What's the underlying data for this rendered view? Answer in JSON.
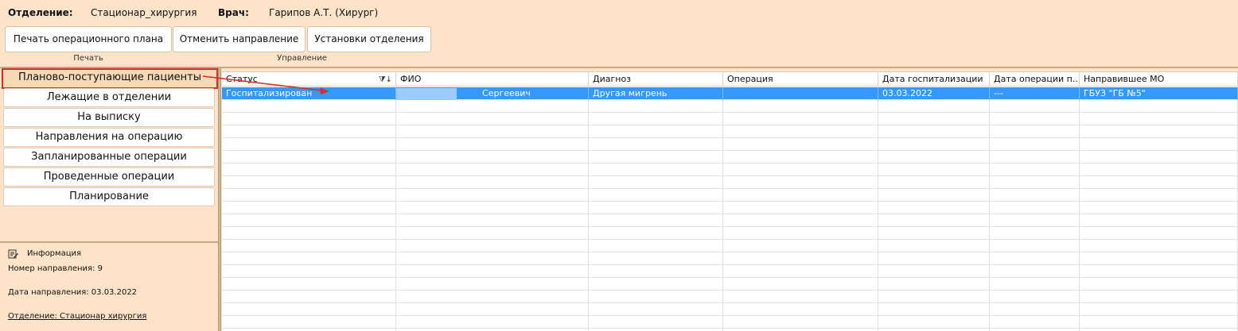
{
  "header": {
    "department_label": "Отделение:",
    "department_value": "Стационар_хирургия",
    "doctor_label": "Врач:",
    "doctor_value": "Гарипов А.Т. (Хирург)"
  },
  "ribbon": {
    "print_plan": "Печать операционного плана",
    "cancel_referral": "Отменить направление",
    "department_settings": "Установки отделения",
    "group_print": "Печать",
    "group_manage": "Управление"
  },
  "nav": {
    "items": [
      "Планово-поступающие пациенты",
      "Лежащие в отделении",
      "На выписку",
      "Направления на операцию",
      "Запланированные операции",
      "Проведенные операции",
      "Планирование"
    ],
    "active_index": 0
  },
  "info": {
    "title": "Информация",
    "referral_number": "Номер направления: 9",
    "referral_date": "Дата направления: 03.03.2022",
    "department": "Отделение: Стационар хирургия"
  },
  "grid": {
    "columns": [
      "Статус",
      "ФИО",
      "Диагноз",
      "Операция",
      "Дата госпитализации",
      "Дата операции п...",
      "Направившее МО"
    ],
    "rows": [
      {
        "status": "Госпитализирован",
        "fio": "Сергеевич",
        "diagnosis": "Другая мигрень",
        "operation": "",
        "hosp_date": "03.03.2022",
        "op_date": "---",
        "referring_mo": "ГБУЗ \"ГБ №5\""
      }
    ]
  },
  "colors": {
    "background": "#fde3c7",
    "selection": "#3399ff",
    "highlight_border": "#d22f2f"
  }
}
